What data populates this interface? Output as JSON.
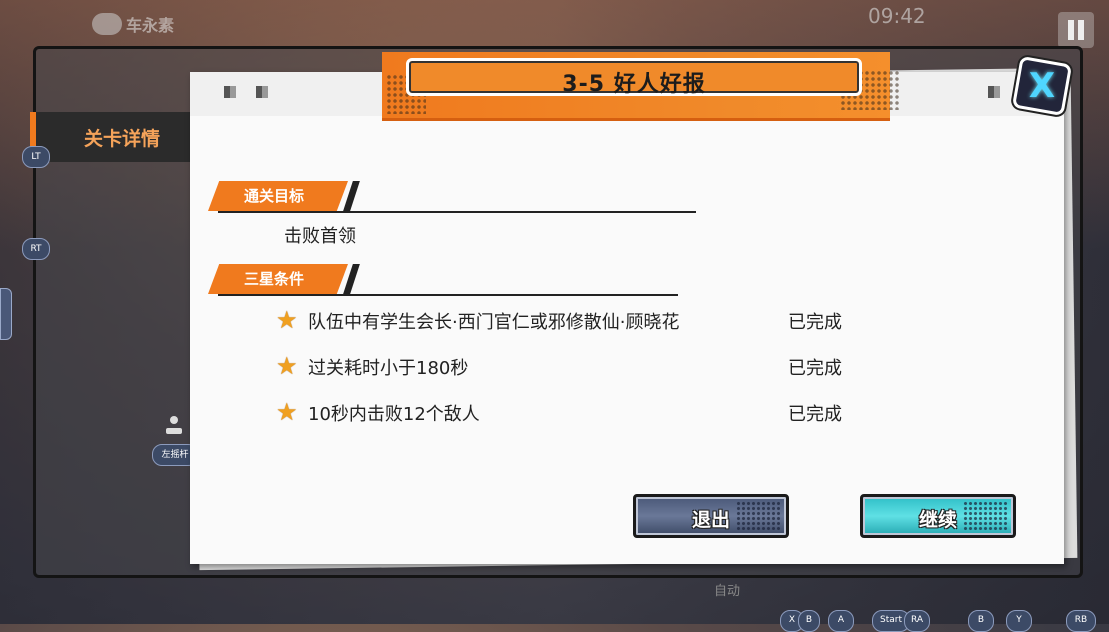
{
  "hud": {
    "logo_text": "车永素",
    "clock": "09:42"
  },
  "side_tab": {
    "label": "关卡详情"
  },
  "controller_hints": {
    "lt": "LT",
    "rt": "RT",
    "left_stick": "左摇杆",
    "bottom": [
      "X",
      "B",
      "A",
      "Start",
      "RA",
      "B",
      "Y",
      "RB"
    ],
    "auto": "自动"
  },
  "dialog": {
    "title": "3-5  好人好报",
    "objective_section": "通关目标",
    "objective": "击败首领",
    "stars_section": "三星条件",
    "conditions": [
      {
        "text": "队伍中有学生会长·西门官仁或邪修散仙·顾晓花",
        "status": "已完成"
      },
      {
        "text": "过关耗时小于180秒",
        "status": "已完成"
      },
      {
        "text": "10秒内击败12个敌人",
        "status": "已完成"
      }
    ],
    "exit_label": "退出",
    "continue_label": "继续",
    "close_icon_glyph": "X"
  },
  "colors": {
    "accent": "#f07a1e",
    "continue": "#2fbfc7",
    "exit": "#4a5878"
  }
}
